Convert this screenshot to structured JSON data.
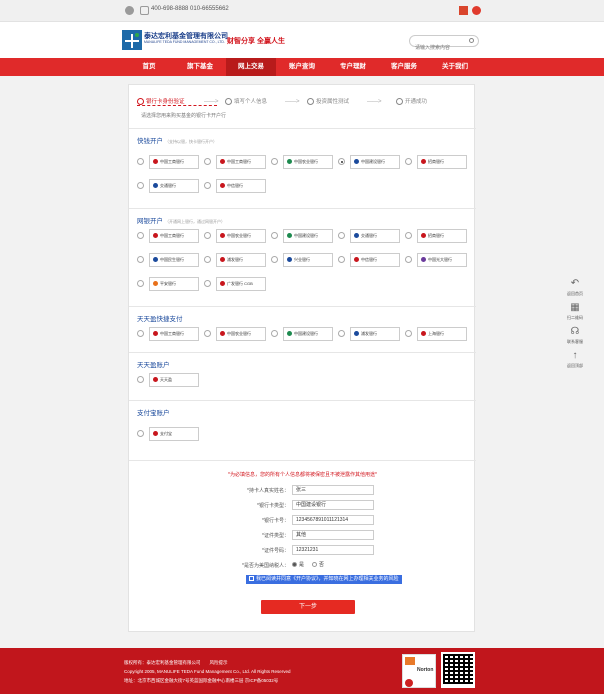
{
  "topbar": {
    "phone": "400-698-8888 010-66555662",
    "wechat_icon": "wechat-icon",
    "phone_icon": "phone-icon"
  },
  "header": {
    "company_cn": "泰达宏利基金管理有限公司",
    "company_en": "MANULIFE TEDA FUND MANAGEMENT CO., LTD.",
    "slogan": "财智分享 全赢人生",
    "search_placeholder": "请输入搜索内容"
  },
  "nav": {
    "items": [
      "首页",
      "旗下基金",
      "网上交易",
      "账户查询",
      "专户理财",
      "客户服务",
      "关于我们"
    ],
    "active_index": 2
  },
  "steps": {
    "items": [
      "银行卡身份验证",
      "填写个人信息",
      "投资属性测试",
      "开通成功"
    ],
    "active_index": 0,
    "notice": "请选择您用来购买基金的银行卡开户行"
  },
  "sections": {
    "kuaijie": {
      "title": "快钱开户",
      "sub": "（支持以银，快卡银行开户）"
    },
    "wangyin": {
      "title": "网银开户",
      "sub": "（开通网上银行，通过网银开户）"
    },
    "tiantian": {
      "title": "天天盈快捷支付"
    },
    "tiantian_acc": {
      "title": "天天盈账户"
    },
    "alipay": {
      "title": "支付宝账户"
    }
  },
  "banks": {
    "kuaijie": [
      "中国工商银行",
      "中国工商银行",
      "中国农业银行",
      "中国建设银行",
      "招商银行",
      "交通银行",
      "中信银行"
    ],
    "kuaijie_selected": 3,
    "wangyin": [
      "中国工商银行",
      "中国农业银行",
      "中国建设银行",
      "交通银行",
      "招商银行",
      "中国民生银行",
      "浦发银行",
      "兴业银行",
      "中信银行",
      "中国光大银行",
      "平安银行",
      "广发银行 CGB"
    ],
    "tiantian": [
      "中国工商银行",
      "中国农业银行",
      "中国建设银行",
      "浦发银行",
      "上海银行"
    ],
    "tiantian_acc": [
      "天天盈"
    ],
    "alipay": [
      "支付宝"
    ]
  },
  "form": {
    "warning": "*为必填信息，您的所有个人信息都将被保密且不被泄露作其他用途*",
    "rows": [
      {
        "label": "*持卡人真实姓名：",
        "value": "张三"
      },
      {
        "label": "*银行卡类型：",
        "value": "中国建设银行"
      },
      {
        "label": "*银行卡号：",
        "value": "1234567891011121314"
      },
      {
        "label": "*证件类型：",
        "value": "其他"
      },
      {
        "label": "*证件号码：",
        "value": "12321231"
      }
    ],
    "resident_label": "*是否为美国纳税人：",
    "resident_yes": "是",
    "resident_no": "否",
    "resident_selected": "yes",
    "agree_text": "我已阅读并同意《开户协议》，并知晓在网上办理相关业务的风险",
    "next_label": "下一步"
  },
  "side": {
    "items": [
      "返回首页",
      "扫二维码",
      "联系客服",
      "返回顶部"
    ]
  },
  "footer": {
    "line1": "版权所有：泰达宏利基金管理有限公司　　风险提示",
    "line2": "Copyright 2005, MANULIFE TEDA Fund Management Co., Ltd. All Rights Reserved",
    "line3": "地址：北京市西城区金融大街7号英蓝国际金融中心南楼三层  京ICP备05032号",
    "badge_text": "Norton"
  }
}
